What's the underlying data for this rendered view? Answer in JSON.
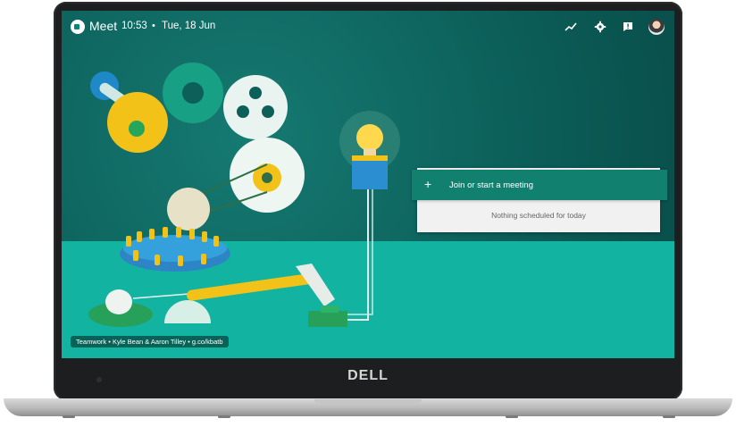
{
  "topbar": {
    "app_title": "Meet",
    "time": "10:53",
    "separator": "•",
    "date": "Tue, 18 Jun"
  },
  "icons": [
    "video-camera-icon",
    "trending-icon",
    "gear-icon",
    "feedback-icon",
    "avatar"
  ],
  "main": {
    "join_label": "Join or start a meeting",
    "join_plus": "+",
    "empty_state": "Nothing scheduled for today"
  },
  "caption": {
    "text": "Teamwork • Kyle Bean & Aaron Tilley • g.co/kbatb"
  },
  "device": {
    "brand": "DELL"
  },
  "colors": {
    "accent": "#11806f",
    "floor": "#12b3a0",
    "wall": "#0b5b56"
  }
}
